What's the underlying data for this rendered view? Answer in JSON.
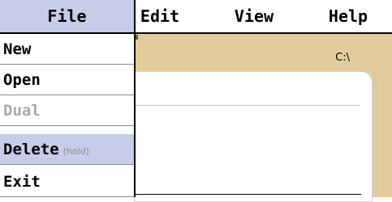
{
  "menubar": {
    "items": [
      {
        "label": "File",
        "active": true
      },
      {
        "label": "Edit",
        "active": false
      },
      {
        "label": "View",
        "active": false
      },
      {
        "label": "Help",
        "active": false
      }
    ]
  },
  "file_menu": {
    "items": [
      {
        "label": "New",
        "enabled": true
      },
      {
        "label": "Open",
        "enabled": true
      },
      {
        "label": "Dual",
        "enabled": false
      },
      {
        "label": "Delete",
        "hint": "(hold)",
        "enabled": true,
        "selected": true
      },
      {
        "label": "Exit",
        "enabled": true
      }
    ]
  },
  "window": {
    "path": "C:\\"
  },
  "colors": {
    "highlight": "#c8cce8",
    "window_bg": "#e2cc9c",
    "disabled_text": "#a8a8a8"
  }
}
